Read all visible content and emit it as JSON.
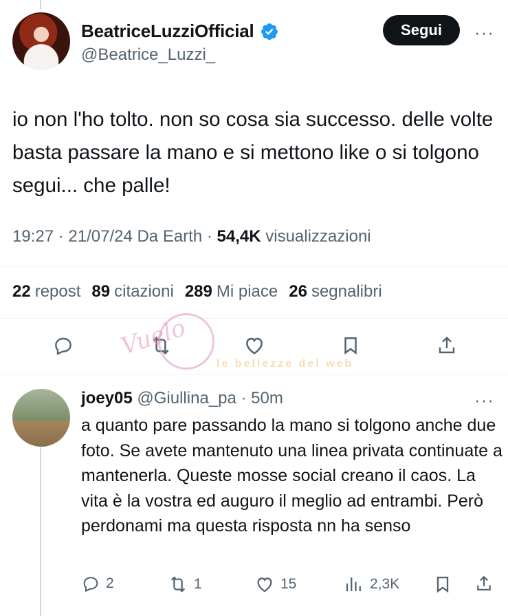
{
  "post": {
    "display_name": "BeatriceLuzziOfficial",
    "handle": "@Beatrice_Luzzi_",
    "follow_label": "Segui",
    "more_label": "···",
    "text": "io non l'ho tolto. non so cosa sia successo. delle volte basta passare la mano e si mettono like o si tolgono segui... che palle!",
    "time_date": "19:27 · 21/07/24 Da Earth · ",
    "views_count": "54,4K",
    "views_label": "visualizzazioni",
    "stats": [
      {
        "count": "22",
        "label": "repost"
      },
      {
        "count": "89",
        "label": "citazioni"
      },
      {
        "count": "289",
        "label": "Mi piace"
      },
      {
        "count": "26",
        "label": "segnalibri"
      }
    ]
  },
  "reply": {
    "display_name": "joey05",
    "handle_time": "@Giullina_pa · 50m",
    "more_label": "···",
    "text": "a quanto pare passando la mano si tolgono anche due foto. Se avete mantenuto una linea privata continuate a mantenerla. Queste mosse social creano il caos. La vita è la vostra ed auguro il meglio ad entrambi. Però perdonami ma questa risposta nn ha senso",
    "replies": "2",
    "reposts": "1",
    "likes": "15",
    "views": "2,3K"
  },
  "watermark": {
    "text1": "Vuelo",
    "text2": "le bellezze del web"
  },
  "colors": {
    "primary_text": "#0f1419",
    "secondary_text": "#536471",
    "verified_blue": "#1d9bf0",
    "divider": "#eff3f4"
  }
}
